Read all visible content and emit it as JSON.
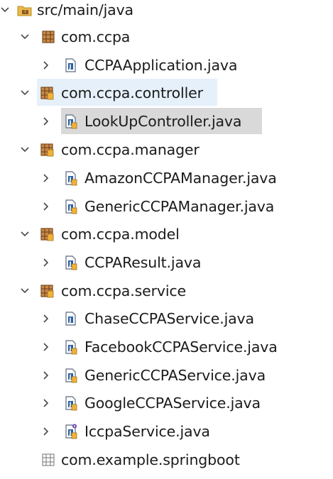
{
  "tree": {
    "source_folder": {
      "label": "src/main/java",
      "icon": "package-folder-icon",
      "expanded": true
    },
    "items": [
      {
        "kind": "package",
        "label": "com.ccpa",
        "icon": "package-icon",
        "expanded": true,
        "children": [
          {
            "kind": "file",
            "label": "CCPAApplication.java",
            "icon": "java-class-icon"
          }
        ]
      },
      {
        "kind": "package",
        "label": "com.ccpa.controller",
        "icon": "package-icon",
        "expanded": true,
        "highlighted": true,
        "children": [
          {
            "kind": "file",
            "label": "LookUpController.java",
            "icon": "java-class-icon",
            "selected": true
          }
        ]
      },
      {
        "kind": "package",
        "label": "com.ccpa.manager",
        "icon": "package-icon",
        "expanded": true,
        "children": [
          {
            "kind": "file",
            "label": "AmazonCCPAManager.java",
            "icon": "java-class-icon"
          },
          {
            "kind": "file",
            "label": "GenericCCPAManager.java",
            "icon": "java-class-icon"
          }
        ]
      },
      {
        "kind": "package",
        "label": "com.ccpa.model",
        "icon": "package-icon",
        "expanded": true,
        "children": [
          {
            "kind": "file",
            "label": "CCPAResult.java",
            "icon": "java-class-icon"
          }
        ]
      },
      {
        "kind": "package",
        "label": "com.ccpa.service",
        "icon": "package-icon",
        "expanded": true,
        "children": [
          {
            "kind": "file",
            "label": "ChaseCCPAService.java",
            "icon": "java-class-icon"
          },
          {
            "kind": "file",
            "label": "FacebookCCPAService.java",
            "icon": "java-class-icon"
          },
          {
            "kind": "file",
            "label": "GenericCCPAService.java",
            "icon": "java-class-icon"
          },
          {
            "kind": "file",
            "label": "GoogleCCPAService.java",
            "icon": "java-class-icon"
          },
          {
            "kind": "file",
            "label": "IccpaService.java",
            "icon": "java-interface-icon"
          }
        ]
      },
      {
        "kind": "package",
        "label": "com.example.springboot",
        "icon": "empty-package-icon",
        "expanded": false
      }
    ]
  },
  "colors": {
    "highlight_band": "#e5f0fa",
    "selection": "#d9d9d9",
    "package_brown": "#8b5a2b",
    "jar_orange": "#d9952b",
    "java_blue": "#2b5f9e"
  }
}
